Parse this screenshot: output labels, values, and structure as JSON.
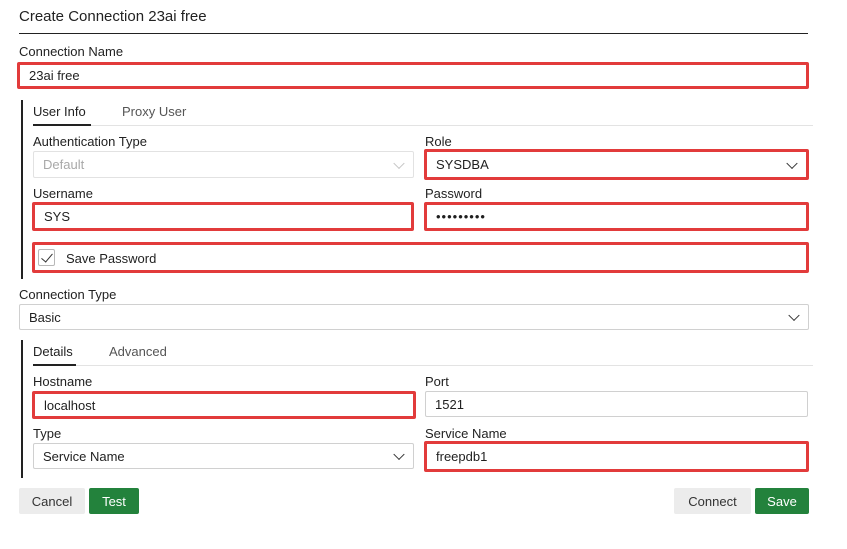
{
  "dialog": {
    "title": "Create Connection 23ai free"
  },
  "connection_name": {
    "label": "Connection Name",
    "value": "23ai free"
  },
  "user_tabs": {
    "active": "User Info",
    "inactive": "Proxy User"
  },
  "auth_type": {
    "label": "Authentication Type",
    "value": "Default"
  },
  "role": {
    "label": "Role",
    "value": "SYSDBA"
  },
  "username": {
    "label": "Username",
    "value": "SYS"
  },
  "password": {
    "label": "Password",
    "value": "•••••••••"
  },
  "save_password": {
    "label": "Save Password",
    "checked": true
  },
  "connection_type": {
    "label": "Connection Type",
    "value": "Basic"
  },
  "detail_tabs": {
    "active": "Details",
    "inactive": "Advanced"
  },
  "hostname": {
    "label": "Hostname",
    "value": "localhost"
  },
  "port": {
    "label": "Port",
    "value": "1521"
  },
  "type": {
    "label": "Type",
    "value": "Service Name"
  },
  "service_name": {
    "label": "Service Name",
    "value": "freepdb1"
  },
  "buttons": {
    "cancel": "Cancel",
    "test": "Test",
    "connect": "Connect",
    "save": "Save"
  },
  "colors": {
    "highlight": "#e23b3b",
    "primary_button": "#23823c",
    "secondary_button": "#ececec"
  }
}
